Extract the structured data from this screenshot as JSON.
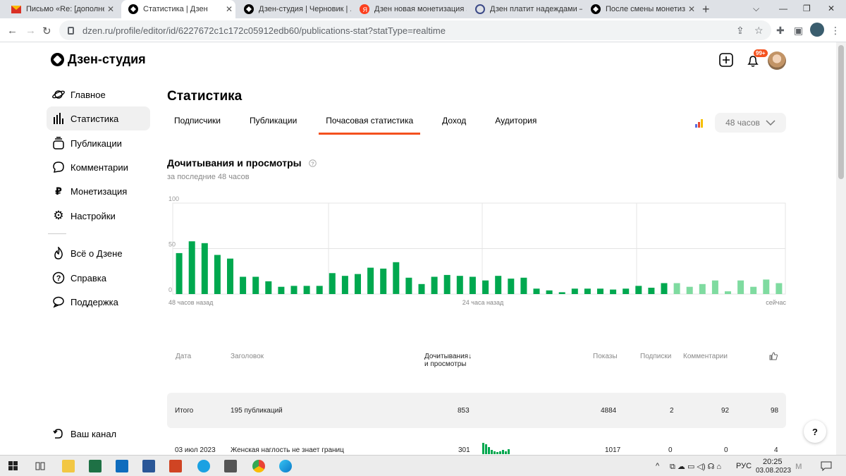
{
  "browser": {
    "tabs": [
      {
        "title": "Письмо «Re: [дополнение]",
        "icon": "mail-icon"
      },
      {
        "title": "Статистика | Дзен",
        "icon": "dzen-icon"
      },
      {
        "title": "Дзен-студия | Черновик | .",
        "icon": "dzen-icon"
      },
      {
        "title": "Дзен новая монетизация з",
        "icon": "yandex-icon"
      },
      {
        "title": "Дзен платит надеждами —",
        "icon": "globe-icon"
      },
      {
        "title": "После смены монетизаци",
        "icon": "dzen-icon"
      }
    ],
    "new_tab": "+",
    "url": "dzen.ru/profile/editor/id/6227672c1c172c05912edb60/publications-stat?statType=realtime"
  },
  "header": {
    "logo": "Дзен-студия",
    "badge": "99+"
  },
  "sidebar": {
    "items": [
      {
        "label": "Главное",
        "icon": "planet-icon"
      },
      {
        "label": "Статистика",
        "icon": "bar-chart-icon"
      },
      {
        "label": "Публикации",
        "icon": "stack-icon"
      },
      {
        "label": "Комментарии",
        "icon": "comment-icon"
      },
      {
        "label": "Монетизация",
        "icon": "ruble-icon"
      },
      {
        "label": "Настройки",
        "icon": "gear-icon"
      }
    ],
    "items2": [
      {
        "label": "Всё о Дзене",
        "icon": "flame-icon"
      },
      {
        "label": "Справка",
        "icon": "question-icon"
      },
      {
        "label": "Поддержка",
        "icon": "chat-icon"
      }
    ],
    "channel": "Ваш канал"
  },
  "main": {
    "title": "Статистика",
    "tabs": [
      "Подписчики",
      "Публикации",
      "Почасовая статистика",
      "Доход",
      "Аудитория"
    ],
    "active_tab": 2,
    "period": "48 часов",
    "section_title": "Дочитывания и просмотры",
    "section_sub": "за последние 48 часов"
  },
  "chart_data": {
    "type": "bar",
    "ylim": [
      0,
      100
    ],
    "y_ticks": [
      "100",
      "50",
      "0"
    ],
    "x_labels": [
      "48 часов назад",
      "24 часа назад",
      "сейчас"
    ],
    "values": [
      45,
      58,
      56,
      43,
      39,
      19,
      19,
      14,
      8,
      9,
      9,
      9,
      23,
      20,
      22,
      29,
      28,
      35,
      18,
      11,
      19,
      21,
      20,
      19,
      15,
      20,
      17,
      18,
      6,
      4,
      2,
      6,
      6,
      6,
      5,
      6,
      9,
      7,
      12,
      12,
      8,
      11,
      15,
      3,
      15,
      8,
      16,
      12
    ],
    "light_from": 39
  },
  "table": {
    "headers": {
      "date": "Дата",
      "title": "Заголовок",
      "reads": "Дочитывания",
      "reads2": "и просмотры",
      "shows": "Показы",
      "subs": "Подписки",
      "comments": "Комментарии"
    },
    "total": {
      "label": "Итого",
      "title": "195 публикаций",
      "reads": "853",
      "shows": "4884",
      "subs": "2",
      "comments": "92",
      "likes": "98"
    },
    "row": {
      "date": "03 июл 2023",
      "title": "Женская наглость не знает границ",
      "reads": "301",
      "shows": "1017",
      "subs": "0",
      "comments": "0",
      "likes": "4"
    }
  },
  "help": "?",
  "taskbar": {
    "lang": "РУС",
    "time": "20:25",
    "date": "03.08.2023"
  }
}
